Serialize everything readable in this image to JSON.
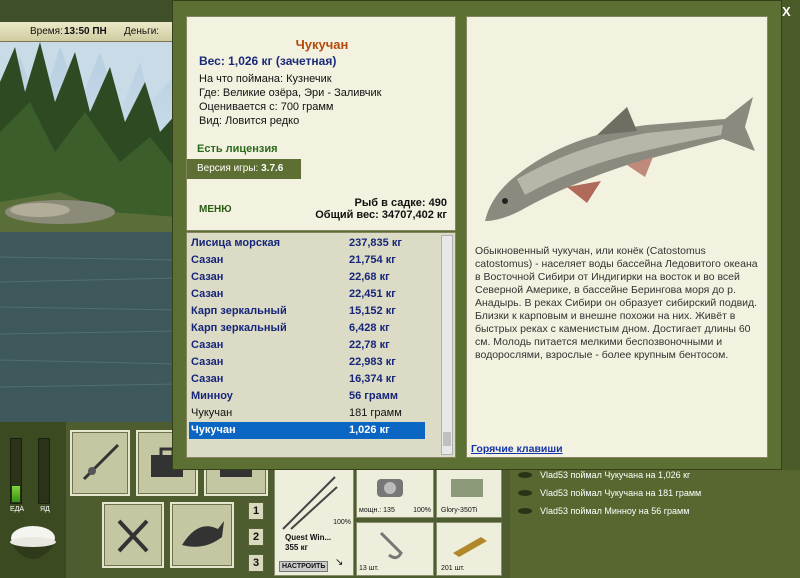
{
  "topbar": {
    "time_label": "Время:",
    "time_value": "13:50 ПН",
    "money_label": "Деньги:"
  },
  "gauges": {
    "left_label": "ЕДА",
    "right_label": "ЯД",
    "left_level": 0.25,
    "right_level": 0.0
  },
  "toolbar": {
    "pages": [
      "1",
      "2",
      "3"
    ],
    "rod_name": "Quest Win...",
    "rod_weight": "355 кг",
    "rod_percent": "100%",
    "setup_button": "НАСТРОИТЬ",
    "reel_power": "мощн.: 135",
    "reel_percent": "100%",
    "lure_name": "Glory-350Ti",
    "hooks_count": "13 шт.",
    "bait_count": "201 шт."
  },
  "log": [
    "Vlad53 поймал Чукучана на 1,026 кг",
    "Vlad53 поймал Чукучана на 181 грамм",
    "Vlad53 поймал Минноу на 56 грамм"
  ],
  "dialog": {
    "close": "X",
    "fish_name": "Чукучан",
    "weight": "Вес: 1,026 кг (зачетная)",
    "caught_on": "На что поймана: Кузнечик",
    "where": "Где: Великие озёра, Эри - Заливчик",
    "valued_from": "Оценивается с: 700 грамм",
    "kind": "Вид: Ловится редко",
    "license": "Есть лицензия",
    "version_label": "Версия игры:",
    "version_value": "3.7.6",
    "menu": "МЕНЮ",
    "fish_in_cage": "Рыб в садке: 490",
    "total_weight": "Общий вес: 34707,402 кг",
    "description": "Обыкновенный чукучан, или конёк (Catostomus catostomus) - населяет воды бассейна Ледовитого океана в Восточной Сибири от Индигирки на восток и во всей Северной Америке, в бассейне Берингова моря до р. Анадырь. В реках Сибири он образует сибирский подвид. Близки к карповым и внешне похожи на них. Живёт в быстрых реках с каменистым дном. Достигает длины 60 см. Молодь питается мелкими беспозвоночными и водорослями, взрослые - более крупным бентосом.",
    "hotkeys": "Горячие клавиши",
    "catches": [
      {
        "name": "Лисица морская",
        "weight": "237,835 кг",
        "style": "bold"
      },
      {
        "name": "Сазан",
        "weight": "21,754 кг",
        "style": "bold"
      },
      {
        "name": "Сазан",
        "weight": "22,68 кг",
        "style": "bold"
      },
      {
        "name": "Сазан",
        "weight": "22,451 кг",
        "style": "bold"
      },
      {
        "name": "Карп зеркальный",
        "weight": "15,152 кг",
        "style": "bold"
      },
      {
        "name": "Карп зеркальный",
        "weight": "6,428 кг",
        "style": "bold"
      },
      {
        "name": "Сазан",
        "weight": "22,78 кг",
        "style": "bold"
      },
      {
        "name": "Сазан",
        "weight": "22,983 кг",
        "style": "bold"
      },
      {
        "name": "Сазан",
        "weight": "16,374 кг",
        "style": "bold"
      },
      {
        "name": "Минноу",
        "weight": "56 грамм",
        "style": "bold"
      },
      {
        "name": "Чукучан",
        "weight": "181 грамм",
        "style": "plain"
      },
      {
        "name": "Чукучан",
        "weight": "1,026 кг",
        "style": "sel"
      }
    ]
  },
  "colors": {
    "frame_green": "#5d7033",
    "title_orange": "#b54a0a",
    "weight_blue": "#1a2a7a",
    "selection_blue": "#0a66c2",
    "link_blue": "#1533a8"
  }
}
